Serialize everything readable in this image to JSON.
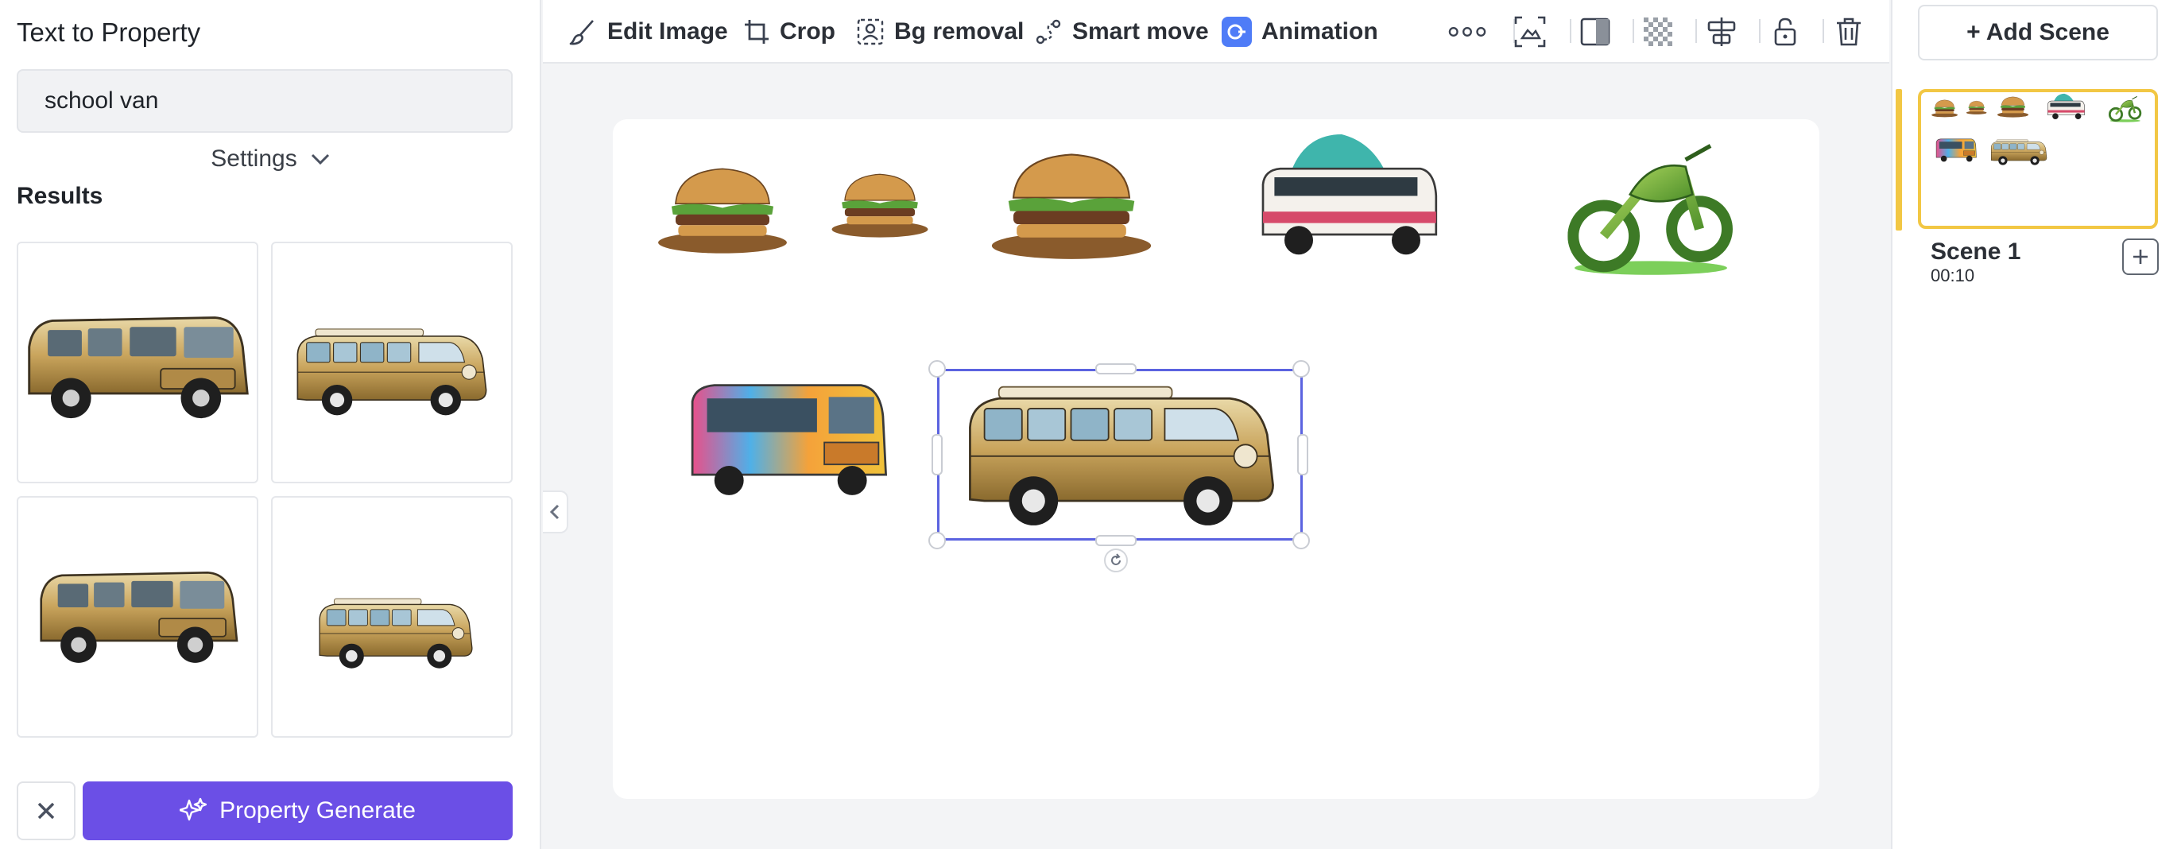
{
  "left_panel": {
    "title": "Text to Property",
    "search_value": "school van",
    "settings_label": "Settings",
    "results_label": "Results",
    "results": [
      {
        "icon": "golden-van-front-view"
      },
      {
        "icon": "golden-vw-van-side-view"
      },
      {
        "icon": "golden-minivan-view"
      },
      {
        "icon": "golden-vw-van-small"
      }
    ],
    "generate_label": "Property Generate"
  },
  "toolbar": {
    "edit_image": "Edit Image",
    "crop": "Crop",
    "bg_removal": "Bg removal",
    "smart_move": "Smart move",
    "animation": "Animation",
    "icons": [
      "more-icon",
      "fit-image-icon",
      "split-icon",
      "transparency-icon",
      "align-center-icon",
      "unlock-icon",
      "trash-icon"
    ]
  },
  "canvas": {
    "items": [
      "burger-1",
      "burger-2",
      "burger-3",
      "teal-bus",
      "green-motorcycle",
      "rainbow-bus",
      "golden-van-selected"
    ]
  },
  "right_panel": {
    "add_scene_label": "+ Add Scene",
    "scenes": [
      {
        "name": "Scene 1",
        "duration": "00:10"
      }
    ]
  },
  "colors": {
    "accent_purple": "#6b4fe6",
    "selection_blue": "#5b63e0",
    "scene_yellow": "#f2c744",
    "van_gold": "#c9a45c"
  }
}
